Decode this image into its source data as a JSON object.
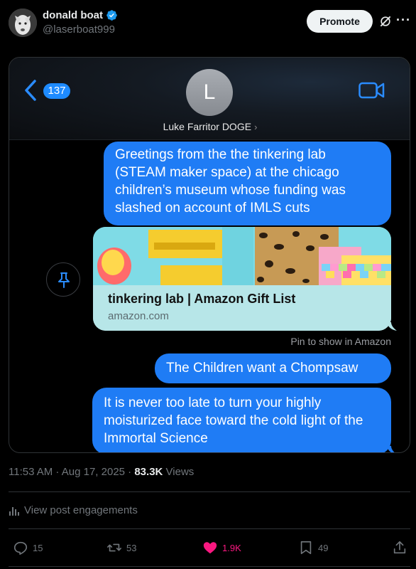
{
  "post": {
    "author_name": "donald boat",
    "handle": "@laserboat999",
    "promote_label": "Promote",
    "timestamp": "11:53 AM · Aug 17, 2025 · ",
    "views_count": "83.3K",
    "views_label": " Views",
    "engagements_label": "View post engagements"
  },
  "screenshot": {
    "unread_count": "137",
    "contact_initial": "L",
    "contact_name": "Luke Farritor DOGE",
    "contact_chevron": "›",
    "messages": [
      "Greetings from the the tinkering lab (STEAM maker space) at the chicago children’s museum whose funding was slashed on account of IMLS cuts",
      "The Children want a Chompsaw",
      "It is never too late to turn your highly moisturized face toward the cold light of the Immortal Science"
    ],
    "link_preview": {
      "title": "tinkering lab | Amazon Gift List",
      "domain": "amazon.com"
    },
    "pin_hint": "Pin to show in Amazon",
    "bubble_color": "#1f7cf5"
  },
  "actions": {
    "replies": "15",
    "reposts": "53",
    "likes": "1.9K",
    "bookmarks": "49"
  },
  "colors": {
    "like_active": "#f91880",
    "verified": "#1d9bf0",
    "muted_text": "#71767b"
  }
}
